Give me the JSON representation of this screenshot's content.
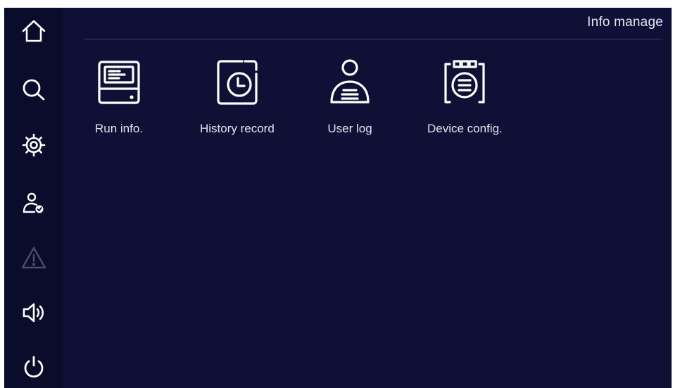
{
  "header": {
    "title": "Info manage"
  },
  "sidebar": {
    "items": [
      {
        "icon": "home-icon"
      },
      {
        "icon": "search-icon"
      },
      {
        "icon": "gear-icon"
      },
      {
        "icon": "user-check-icon"
      },
      {
        "icon": "warning-icon",
        "state": "disabled"
      },
      {
        "icon": "speaker-icon"
      },
      {
        "icon": "power-icon"
      }
    ]
  },
  "tiles": [
    {
      "label": "Run info.",
      "icon": "run-info-icon"
    },
    {
      "label": "History record",
      "icon": "history-clock-icon"
    },
    {
      "label": "User log",
      "icon": "user-log-icon"
    },
    {
      "label": "Device config.",
      "icon": "device-config-icon"
    }
  ],
  "colors": {
    "background": "#0f1036",
    "sidebar": "#0b0b2b",
    "icon": "#ffffff",
    "disabled_icon": "#4a4b6b",
    "text": "#e4e4ee"
  }
}
